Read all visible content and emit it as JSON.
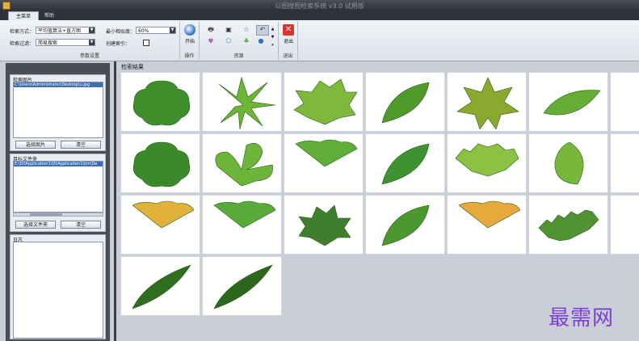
{
  "window": {
    "title": "以图搜图检索系统 v3.0 试用版"
  },
  "menu": {
    "tabs": [
      {
        "label": "主菜单",
        "active": true
      },
      {
        "label": "帮助",
        "active": false
      }
    ]
  },
  "ribbon": {
    "params": {
      "search_method_label": "检索方式：",
      "search_method_value": "平均值算法+直方图",
      "filter_label": "检索过滤：",
      "filter_value": "简易搜索",
      "min_similarity_label": "最小相似度：",
      "min_similarity_value": "60%",
      "create_index_label": "创建索引：",
      "group_label": "参数设置"
    },
    "operate": {
      "start_label": "开始",
      "group_label": "操作"
    },
    "resources": {
      "group_label": "资源"
    },
    "exit": {
      "exit_label": "退出",
      "group_label": "退出"
    }
  },
  "left_panel": {
    "search_image": {
      "title": "检索图片",
      "items": [
        "C:\\Users\\Administrator\\Desktop\\u.jpg"
      ],
      "select_button": "选择图片",
      "clear_button": "清空"
    },
    "target_folder": {
      "title": "目标文件夹",
      "items": [
        "E:\\DI\\Application1\\DI\\Application1\\bin\\De"
      ],
      "select_button": "选择文件夹",
      "clear_button": "清空"
    },
    "log": {
      "title": "日志"
    }
  },
  "results": {
    "title": "检索结果",
    "thumbnails": [
      {
        "shape": "grape",
        "color": "#3f8e2c"
      },
      {
        "shape": "palmate",
        "color": "#6cb536"
      },
      {
        "shape": "maple",
        "color": "#7fb93b"
      },
      {
        "shape": "ellipse",
        "color": "#4f9a2a"
      },
      {
        "shape": "star",
        "color": "#8aa92e"
      },
      {
        "shape": "ellipse-right",
        "color": "#66ad35"
      },
      {
        "shape": "partial",
        "color": "#4e9a2d"
      },
      {
        "shape": "grape",
        "color": "#3b8a2a"
      },
      {
        "shape": "trifoliate",
        "color": "#6db53a"
      },
      {
        "shape": "fan",
        "color": "#5fae3a"
      },
      {
        "shape": "ellipse",
        "color": "#3e9230"
      },
      {
        "shape": "serrate-broad",
        "color": "#8cc244"
      },
      {
        "shape": "ovate",
        "color": "#77b83a"
      },
      {
        "shape": "partial",
        "color": "#5a9e30"
      },
      {
        "shape": "fan",
        "color": "#e0b23a"
      },
      {
        "shape": "fan",
        "color": "#58ab38"
      },
      {
        "shape": "maple-small",
        "color": "#3f7e2f"
      },
      {
        "shape": "ellipse",
        "color": "#4b982e"
      },
      {
        "shape": "fan",
        "color": "#e7a83c"
      },
      {
        "shape": "serrate-long",
        "color": "#4f9332"
      },
      {
        "shape": "partial",
        "color": "#4a8d2c"
      },
      {
        "shape": "lanceolate",
        "color": "#2f6e1e"
      },
      {
        "shape": "lanceolate",
        "color": "#2d661d"
      }
    ]
  },
  "watermark": {
    "text": "最需网",
    "color": "#7b3fd1"
  }
}
